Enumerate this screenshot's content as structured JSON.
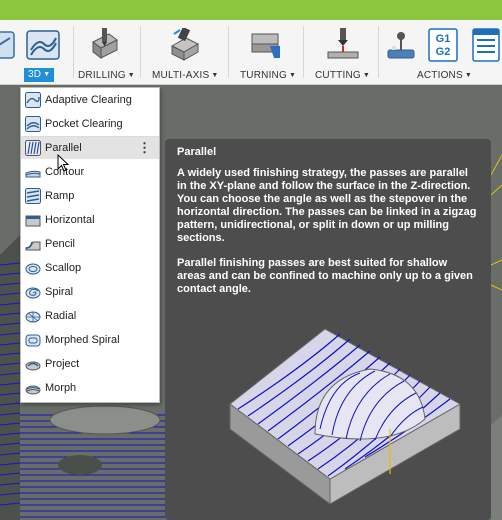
{
  "toolbar": {
    "groups": [
      {
        "label": "3D",
        "icon": "3d-milling-icon",
        "active": true
      },
      {
        "label": "DRILLING",
        "icon": "drill-icon"
      },
      {
        "label": "MULTI-AXIS",
        "icon": "multi-axis-icon"
      },
      {
        "label": "TURNING",
        "icon": "turning-icon"
      },
      {
        "label": "CUTTING",
        "icon": "cutting-icon"
      },
      {
        "label": "ACTIONS",
        "icon": "actions-icon"
      }
    ],
    "actions_icons": [
      "simulate-icon",
      "g1-g2-icon",
      "setup-sheet-icon"
    ],
    "actions_g1": "G1",
    "actions_g2": "G2"
  },
  "menu": {
    "items": [
      {
        "label": "Adaptive Clearing",
        "icon": "adaptive-clearing-icon"
      },
      {
        "label": "Pocket Clearing",
        "icon": "pocket-clearing-icon"
      },
      {
        "label": "Parallel",
        "icon": "parallel-icon",
        "hover": true
      },
      {
        "label": "Contour",
        "icon": "contour-icon"
      },
      {
        "label": "Ramp",
        "icon": "ramp-icon"
      },
      {
        "label": "Horizontal",
        "icon": "horizontal-icon"
      },
      {
        "label": "Pencil",
        "icon": "pencil-icon"
      },
      {
        "label": "Scallop",
        "icon": "scallop-icon"
      },
      {
        "label": "Spiral",
        "icon": "spiral-icon"
      },
      {
        "label": "Radial",
        "icon": "radial-icon"
      },
      {
        "label": "Morphed Spiral",
        "icon": "morphed-spiral-icon"
      },
      {
        "label": "Project",
        "icon": "project-icon"
      },
      {
        "label": "Morph",
        "icon": "morph-icon"
      }
    ],
    "more_glyph": "⋮"
  },
  "tooltip": {
    "title": "Parallel",
    "paragraph1": "A widely used finishing strategy, the passes are parallel in the XY-plane and follow the surface in the Z-direction. You can choose the angle as well as the stepover in the horizontal direction. The passes can be linked in a zigzag pattern, unidirectional, or split in down or up milling sections.",
    "paragraph2": "Parallel finishing passes are best suited for shallow areas and can be confined to machine only up to a given contact angle."
  },
  "colors": {
    "accent_green": "#8cc63f",
    "active_blue": "#1f8fd8",
    "tooltip_bg": "#4d4d4d",
    "toolpath_blue": "#1010c8"
  }
}
